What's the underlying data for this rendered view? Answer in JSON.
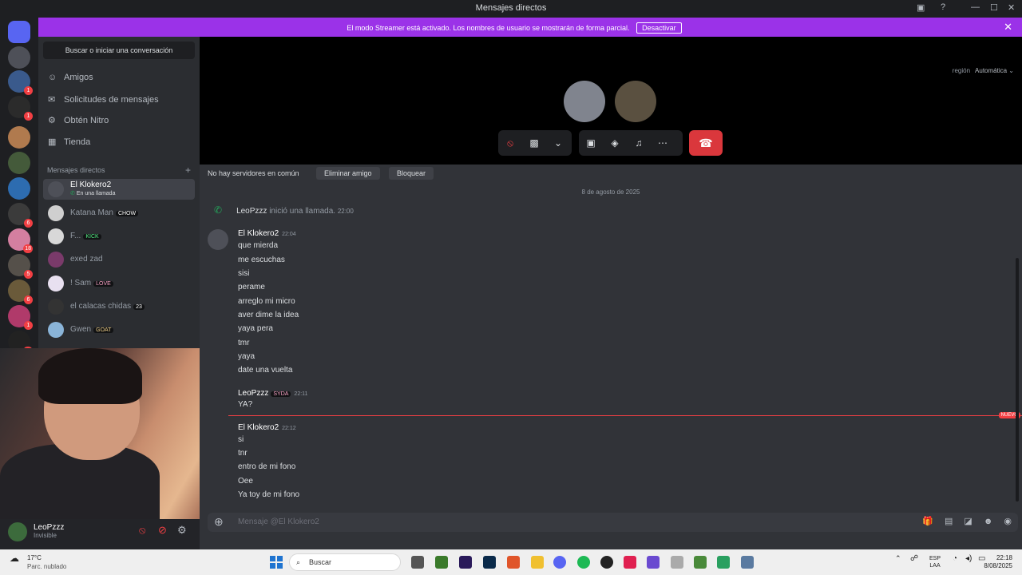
{
  "window": {
    "title": "Mensajes directos"
  },
  "banner": {
    "message": "El modo Streamer está activado. Los nombres de usuario se mostrarán de forma parcial.",
    "button_label": "Desactivar"
  },
  "server_badges": [
    "1",
    "1",
    "6",
    "18",
    "5",
    "6",
    "1",
    "22"
  ],
  "sidebar": {
    "search_label": "Buscar o iniciar una conversación",
    "nav": [
      {
        "label": "Amigos",
        "icon": "friends-icon"
      },
      {
        "label": "Solicitudes de mensajes",
        "icon": "mail-icon"
      },
      {
        "label": "Obtén Nitro",
        "icon": "nitro-icon"
      },
      {
        "label": "Tienda",
        "icon": "shop-icon"
      }
    ],
    "dm_header": "Mensajes directos",
    "dms": [
      {
        "name": "El Klokero2",
        "sub": "En una llamada",
        "tag": ""
      },
      {
        "name": "Katana Man",
        "sub": "",
        "tag": "CHOW"
      },
      {
        "name": "F...",
        "sub": "",
        "tag": "KICK"
      },
      {
        "name": "exed zad",
        "sub": "",
        "tag": ""
      },
      {
        "name": "! Sam",
        "sub": "",
        "tag": "LOVE"
      },
      {
        "name": "el calacas chidas",
        "sub": "",
        "tag": "23"
      },
      {
        "name": "Gwen",
        "sub": "",
        "tag": "GOAT"
      }
    ]
  },
  "user": {
    "name": "LeoPzzz",
    "status": "Invisible"
  },
  "call": {
    "region_label": "región",
    "region_value": "Automática"
  },
  "profile_bar": {
    "text": "No hay servidores en común",
    "remove_label": "Eliminar amigo",
    "block_label": "Bloquear"
  },
  "chat": {
    "date": "8 de agosto de 2025",
    "system": {
      "user": "LeoPzzz",
      "text": "inició una llamada.",
      "time": "22:00"
    },
    "groups": [
      {
        "author": "El Klokero2",
        "time": "22:04",
        "tag": "",
        "lines": [
          "que mierda",
          "me escuchas",
          "sisi",
          "perame",
          "arreglo mi micro",
          "aver dime la idea",
          "yaya pera",
          "tmr",
          "yaya",
          "date una vuelta"
        ]
      },
      {
        "author": "LeoPzzz",
        "time": "22:11",
        "tag": "SYDA",
        "lines": [
          "YA?"
        ]
      },
      {
        "author": "El Klokero2",
        "time": "22:12",
        "tag": "",
        "lines": [
          "si",
          "tnr",
          "entro de mi fono",
          "Oee",
          "Ya toy de mi fono"
        ]
      }
    ],
    "new_label": "NUEVO"
  },
  "composer": {
    "placeholder": "Mensaje @El Klokero2"
  },
  "taskbar": {
    "temperature": "17°C",
    "weather": "Parc. nublado",
    "search": "Buscar",
    "lang_top": "ESP",
    "lang_bottom": "LAA",
    "time": "22:18",
    "date": "8/08/2025"
  },
  "colors": {
    "accent": "#5865f2",
    "banner": "#9b32e8",
    "danger": "#da373c",
    "online": "#23a55a"
  }
}
